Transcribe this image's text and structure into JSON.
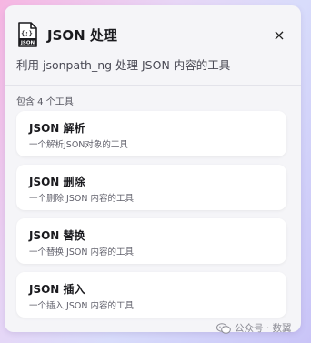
{
  "header": {
    "icon": "json-file-icon",
    "icon_braces": "{;}",
    "icon_caption": "JSON",
    "title": "JSON 处理",
    "close_label": "×",
    "subtitle": "利用 jsonpath_ng 处理 JSON 内容的工具"
  },
  "tools": {
    "count_label": "包含 4 个工具",
    "items": [
      {
        "name": "JSON 解析",
        "description": "一个解析JSON对象的工具"
      },
      {
        "name": "JSON 删除",
        "description": "一个删除 JSON 内容的工具"
      },
      {
        "name": "JSON 替换",
        "description": "一个替换 JSON 内容的工具"
      },
      {
        "name": "JSON 插入",
        "description": "一个插入 JSON 内容的工具"
      }
    ]
  },
  "watermark": {
    "icon": "wechat-icon",
    "text": "公众号 · 数翼"
  }
}
